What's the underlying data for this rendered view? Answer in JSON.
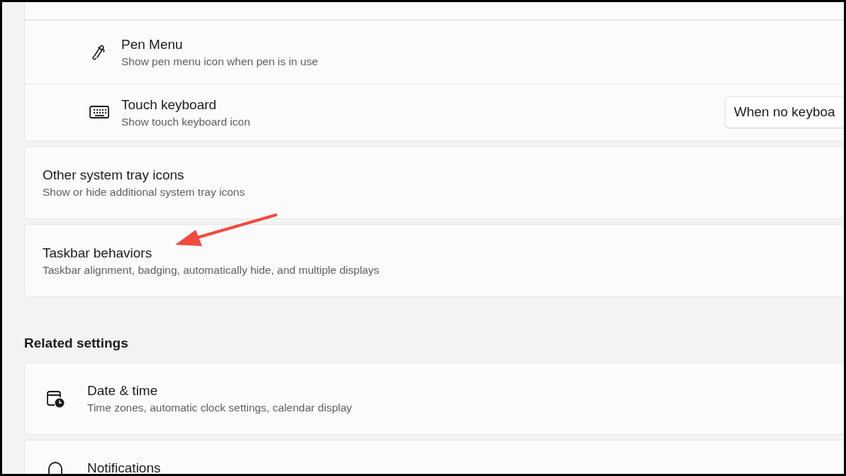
{
  "cards": [
    {
      "kind": "blank"
    },
    {
      "kind": "group",
      "rows": [
        {
          "title": "Pen Menu",
          "subtitle": "Show pen menu icon when pen is in use"
        },
        {
          "title": "Touch keyboard",
          "subtitle": "Show touch keyboard icon",
          "dropdown": "When no keyboa"
        }
      ]
    },
    {
      "kind": "single",
      "title": "Other system tray icons",
      "subtitle": "Show or hide additional system tray icons"
    },
    {
      "kind": "single",
      "title": "Taskbar behaviors",
      "subtitle": "Taskbar alignment, badging, automatically hide, and multiple displays"
    }
  ],
  "related": {
    "heading": "Related settings",
    "items": [
      {
        "title": "Date & time",
        "subtitle": "Time zones, automatic clock settings, calendar display"
      },
      {
        "title": "Notifications"
      }
    ]
  }
}
